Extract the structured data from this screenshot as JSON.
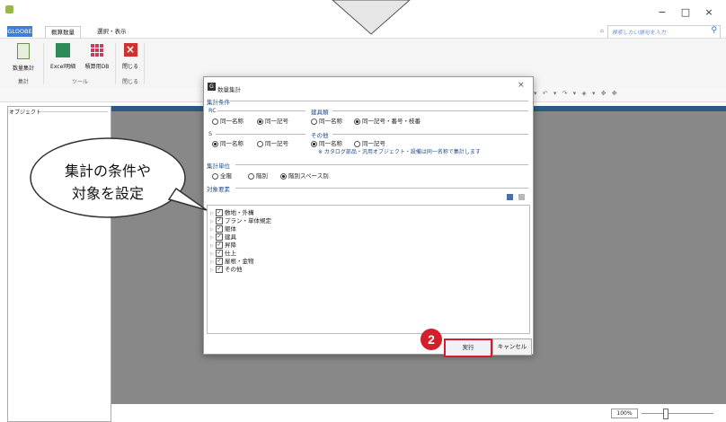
{
  "window": {
    "title": "概算数量",
    "min_label": "−",
    "max_label": "□",
    "close_label": "×"
  },
  "ribbon": {
    "tabs": [
      "GLOOBE",
      "概算数量",
      "選択・表示"
    ],
    "search_placeholder": "検索したい語句を入力",
    "buttons": [
      {
        "label": "数量集計",
        "group": "集計"
      },
      {
        "label": "Excel明細",
        "group": "ツール"
      },
      {
        "label": "積算用DB",
        "group": "ツール"
      },
      {
        "label": "閉じる",
        "group": "閉じる"
      }
    ],
    "groups": [
      "集計",
      "ツール",
      "閉じる"
    ]
  },
  "panel": {
    "label": "オブジェクト"
  },
  "status": {
    "zoom": "100%"
  },
  "dialog": {
    "title": "数量集計",
    "section_conditions": "集計条件",
    "rc": {
      "label": "RC",
      "options": [
        "同一名称",
        "同一記号"
      ],
      "selected": 1
    },
    "fittings": {
      "label": "建具類",
      "options": [
        "同一名称",
        "同一記号・番号・枝番"
      ],
      "selected": 1
    },
    "s": {
      "label": "S",
      "options": [
        "同一名称",
        "同一記号"
      ],
      "selected": 0
    },
    "other": {
      "label": "その他",
      "options": [
        "同一名称",
        "同一記号"
      ],
      "selected": 0,
      "note": "※ カタログ部品・汎用オブジェクト・設備は同一名称で集計します"
    },
    "unit": {
      "label": "集計単位",
      "options": [
        "全階",
        "階別",
        "階別スペース別"
      ],
      "selected": 2
    },
    "targets_label": "対象要素",
    "tree": [
      "敷地・外構",
      "プラン・単体規定",
      "躯体",
      "建具",
      "昇降",
      "仕上",
      "屋根・金物",
      "その他"
    ],
    "run_label": "実行",
    "cancel_label": "キャンセル"
  },
  "annotation": {
    "callout_line1": "集計の条件や",
    "callout_line2": "対象を設定",
    "badge": "2"
  },
  "colors": {
    "accent": "#3c7fd9",
    "highlight": "#d21f2a",
    "canvas": "#888888",
    "canvas_header": "#2d5a85"
  }
}
